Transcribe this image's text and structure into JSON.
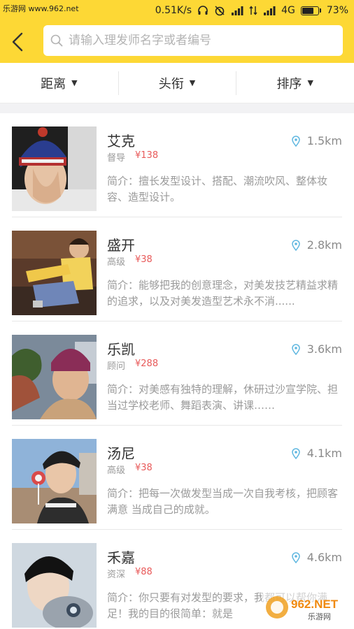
{
  "status_bar": {
    "site_watermark": "乐游网 www.962.net",
    "speed": "0.51K/s",
    "network": "4G",
    "battery": "73%",
    "battery_level": 0.73
  },
  "header": {
    "search_placeholder": "请输入理发师名字或者编号"
  },
  "filters": [
    {
      "label": "距离"
    },
    {
      "label": "头衔"
    },
    {
      "label": "排序"
    }
  ],
  "stylists": [
    {
      "name": "艾克",
      "title": "督导",
      "price": "¥138",
      "distance": "1.5km",
      "intro": "简介：擅长发型设计、搭配、潮流吹风、整体妆容、造型设计。"
    },
    {
      "name": "盛开",
      "title": "高级",
      "price": "¥38",
      "distance": "2.8km",
      "intro": "简介：能够把我的创意理念，对美发技艺精益求精的追求，以及对美发造型艺术永不消......"
    },
    {
      "name": "乐凯",
      "title": "顾问",
      "price": "¥288",
      "distance": "3.6km",
      "intro": "简介：对美感有独特的理解，休研过沙宣学院、担当过学校老师、舞蹈表演、讲课……"
    },
    {
      "name": "汤尼",
      "title": "高级",
      "price": "¥38",
      "distance": "4.1km",
      "intro": "简介：把每一次做发型当成一次自我考核，把顾客 满意 当成自己的成就。"
    },
    {
      "name": "禾嘉",
      "title": "资深",
      "price": "¥88",
      "distance": "4.6km",
      "intro": "简介：你只要有对发型的要求，我都可以帮你满足！我的目的很简单：就是"
    }
  ],
  "watermark": {
    "text": "962.NET",
    "sub": "乐游网"
  },
  "colors": {
    "accent_yellow": "#fdd835",
    "price_red": "#e85a5a",
    "location_blue": "#5fb7e0"
  }
}
